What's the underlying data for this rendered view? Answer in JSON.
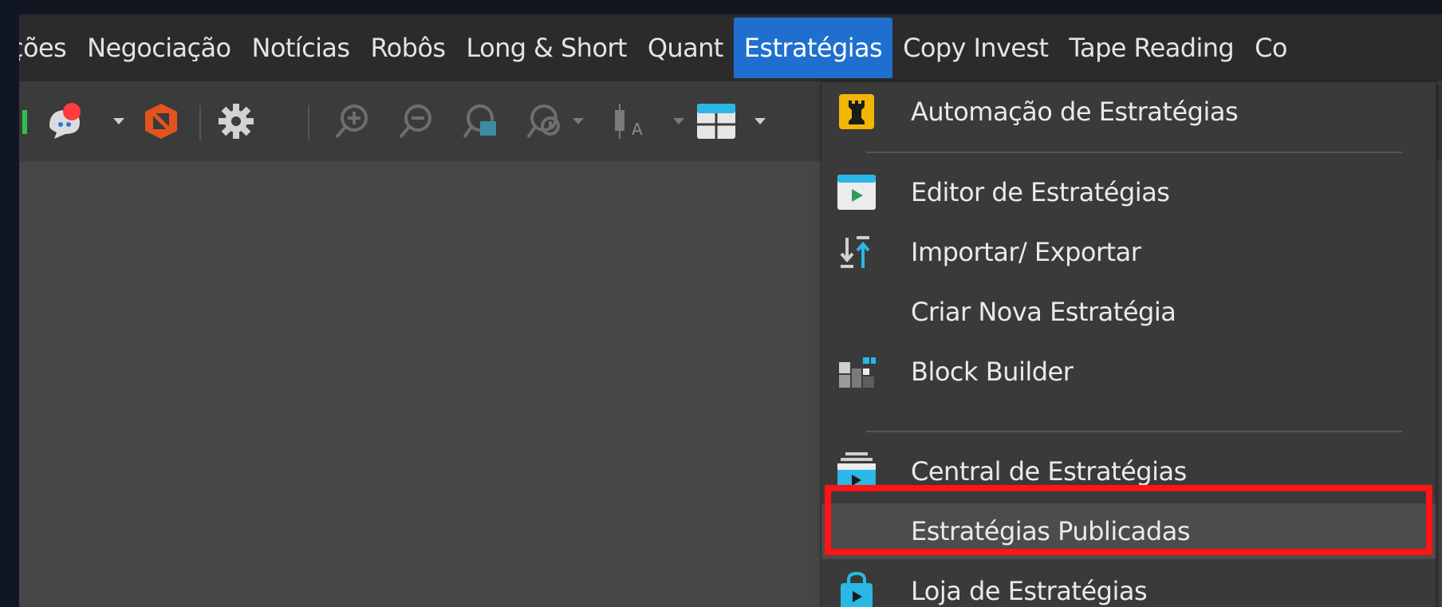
{
  "menubar": {
    "items": [
      {
        "label": "ções",
        "active": false
      },
      {
        "label": "Negociação",
        "active": false
      },
      {
        "label": "Notícias",
        "active": false
      },
      {
        "label": "Robôs",
        "active": false
      },
      {
        "label": "Long & Short",
        "active": false
      },
      {
        "label": "Quant",
        "active": false
      },
      {
        "label": "Estratégias",
        "active": true
      },
      {
        "label": "Copy Invest",
        "active": false
      },
      {
        "label": "Tape Reading",
        "active": false
      },
      {
        "label": "Co",
        "active": false
      }
    ]
  },
  "toolbar": {
    "icons": [
      "green-bar-icon",
      "chat-notification-icon",
      "no-signal-icon",
      "gear-icon",
      "zoom-in-icon",
      "zoom-out-icon",
      "zoom-window-icon",
      "zoom-history-icon",
      "candle-a-icon",
      "layout-grid-icon"
    ],
    "candle_letter": "A"
  },
  "dropdown": {
    "items": [
      {
        "label": "Automação de Estratégias",
        "icon": "chess-rook-icon"
      },
      {
        "label": "Editor de Estratégias",
        "icon": "play-window-icon"
      },
      {
        "label": "Importar/ Exportar",
        "icon": "import-export-icon"
      },
      {
        "label": "Criar Nova Estratégia",
        "icon": ""
      },
      {
        "label": "Block Builder",
        "icon": "blocks-icon"
      },
      {
        "label": "Central de Estratégias",
        "icon": "stack-play-icon"
      },
      {
        "label": "Estratégias Publicadas",
        "icon": ""
      },
      {
        "label": "Loja de Estratégias",
        "icon": "shopping-bag-icon"
      }
    ],
    "highlighted_item": "Estratégias Publicadas"
  },
  "colors": {
    "active_menu": "#1f6fd0",
    "highlight_border": "#ff1414",
    "accent_cyan": "#2bb8e6"
  }
}
